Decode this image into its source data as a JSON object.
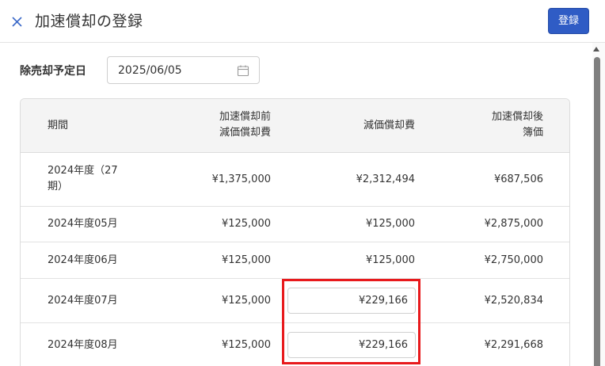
{
  "header": {
    "title": "加速償却の登録",
    "register_label": "登録"
  },
  "form": {
    "planned_sale_date_label": "除売却予定日",
    "planned_sale_date_value": "2025/06/05"
  },
  "table": {
    "columns": [
      "期間",
      "加速償却前\n減価償却費",
      "減価償却費",
      "加速償却後\n簿価"
    ],
    "rows": [
      {
        "period": "2024年度（27\n期）",
        "before": "¥1,375,000",
        "depreciation": "¥2,312,494",
        "book_value": "¥687,506",
        "editable": false
      },
      {
        "period": "2024年度05月",
        "before": "¥125,000",
        "depreciation": "¥125,000",
        "book_value": "¥2,875,000",
        "editable": false
      },
      {
        "period": "2024年度06月",
        "before": "¥125,000",
        "depreciation": "¥125,000",
        "book_value": "¥2,750,000",
        "editable": false
      },
      {
        "period": "2024年度07月",
        "before": "¥125,000",
        "depreciation": "¥229,166",
        "book_value": "¥2,520,834",
        "editable": true
      },
      {
        "period": "2024年度08月",
        "before": "¥125,000",
        "depreciation": "¥229,166",
        "book_value": "¥2,291,668",
        "editable": true
      }
    ]
  },
  "colors": {
    "accent": "#2f5cc5",
    "highlight": "#e8191c",
    "header_bg": "#f4f4f4"
  },
  "icons": {
    "close": "close-icon",
    "calendar": "calendar-icon"
  }
}
